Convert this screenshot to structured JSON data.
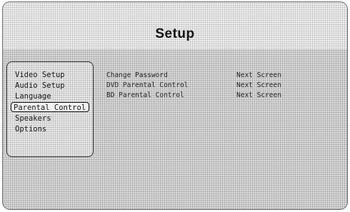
{
  "screen": {
    "title": "Setup"
  },
  "menu": {
    "items": [
      {
        "label": "Video Setup",
        "selected": false
      },
      {
        "label": "Audio Setup",
        "selected": false
      },
      {
        "label": "Language",
        "selected": false
      },
      {
        "label": "Parental Control",
        "selected": true
      },
      {
        "label": "Speakers",
        "selected": false
      },
      {
        "label": "Options",
        "selected": false
      }
    ]
  },
  "settings": {
    "rows": [
      {
        "label": "Change Password",
        "value": "Next Screen"
      },
      {
        "label": "DVD Parental Control",
        "value": "Next Screen"
      },
      {
        "label": "BD Parental Control",
        "value": "Next Screen"
      }
    ]
  }
}
